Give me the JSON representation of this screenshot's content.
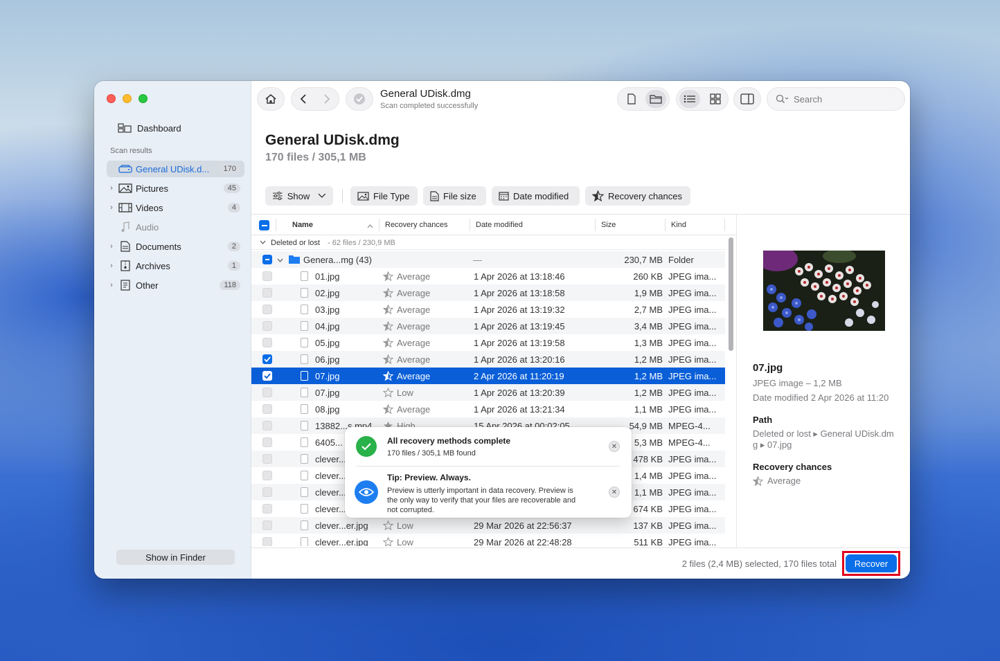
{
  "window": {
    "title": "General UDisk.dmg",
    "subtitle": "Scan completed successfully"
  },
  "sidebar": {
    "dashboard": "Dashboard",
    "section": "Scan results",
    "items": [
      {
        "label": "General UDisk.d...",
        "count": "170",
        "icon": "drive-icon"
      },
      {
        "label": "Pictures",
        "count": "45",
        "icon": "picture-icon"
      },
      {
        "label": "Videos",
        "count": "4",
        "icon": "film-icon"
      },
      {
        "label": "Audio",
        "count": "",
        "icon": "music-note-icon"
      },
      {
        "label": "Documents",
        "count": "2",
        "icon": "document-icon"
      },
      {
        "label": "Archives",
        "count": "1",
        "icon": "archive-icon"
      },
      {
        "label": "Other",
        "count": "118",
        "icon": "other-file-icon"
      }
    ],
    "show_in_finder": "Show in Finder"
  },
  "toolbar": {
    "search_placeholder": "Search"
  },
  "header": {
    "title": "General UDisk.dmg",
    "subtitle": "170 files / 305,1 MB"
  },
  "filters": {
    "show": "Show",
    "file_type": "File Type",
    "file_size": "File size",
    "date_modified": "Date modified",
    "recovery_chances": "Recovery chances"
  },
  "columns": {
    "name": "Name",
    "recovery": "Recovery chances",
    "date": "Date modified",
    "size": "Size",
    "kind": "Kind"
  },
  "group": {
    "label": "Deleted or lost",
    "meta": " - 62 files / 230,9 MB"
  },
  "folder": {
    "name": "Genera...mg (43)",
    "recovery": "—",
    "size": "230,7 MB",
    "kind": "Folder"
  },
  "rows": [
    {
      "name": "01.jpg",
      "recovery": "Average",
      "date": "1 Apr 2026 at 13:18:46",
      "size": "260 KB",
      "kind": "JPEG ima..."
    },
    {
      "name": "02.jpg",
      "recovery": "Average",
      "date": "1 Apr 2026 at 13:18:58",
      "size": "1,9 MB",
      "kind": "JPEG ima..."
    },
    {
      "name": "03.jpg",
      "recovery": "Average",
      "date": "1 Apr 2026 at 13:19:32",
      "size": "2,7 MB",
      "kind": "JPEG ima..."
    },
    {
      "name": "04.jpg",
      "recovery": "Average",
      "date": "1 Apr 2026 at 13:19:45",
      "size": "3,4 MB",
      "kind": "JPEG ima..."
    },
    {
      "name": "05.jpg",
      "recovery": "Average",
      "date": "1 Apr 2026 at 13:19:58",
      "size": "1,3 MB",
      "kind": "JPEG ima..."
    },
    {
      "name": "06.jpg",
      "recovery": "Average",
      "date": "1 Apr 2026 at 13:20:16",
      "size": "1,2 MB",
      "kind": "JPEG ima..."
    },
    {
      "name": "07.jpg",
      "recovery": "Average",
      "date": "2 Apr 2026 at 11:20:19",
      "size": "1,2 MB",
      "kind": "JPEG ima..."
    },
    {
      "name": "07.jpg",
      "recovery": "Low",
      "date": "1 Apr 2026 at 13:20:39",
      "size": "1,2 MB",
      "kind": "JPEG ima..."
    },
    {
      "name": "08.jpg",
      "recovery": "Average",
      "date": "1 Apr 2026 at 13:21:34",
      "size": "1,1 MB",
      "kind": "JPEG ima..."
    },
    {
      "name": "13882...s.mp4",
      "recovery": "High",
      "date": "15 Apr 2026 at 00:02:05",
      "size": "54,9 MB",
      "kind": "MPEG-4..."
    },
    {
      "name": "6405...",
      "recovery": "",
      "date": "",
      "size": "5,3 MB",
      "kind": "MPEG-4..."
    },
    {
      "name": "clever...",
      "recovery": "",
      "date": "",
      "size": "478 KB",
      "kind": "JPEG ima..."
    },
    {
      "name": "clever...",
      "recovery": "",
      "date": "",
      "size": "1,4 MB",
      "kind": "JPEG ima..."
    },
    {
      "name": "clever...",
      "recovery": "",
      "date": "",
      "size": "1,1 MB",
      "kind": "JPEG ima..."
    },
    {
      "name": "clever...",
      "recovery": "",
      "date": "",
      "size": "674 KB",
      "kind": "JPEG ima..."
    },
    {
      "name": "clever...er.jpg",
      "recovery": "Low",
      "date": "29 Mar 2026 at 22:56:37",
      "size": "137 KB",
      "kind": "JPEG ima..."
    },
    {
      "name": "clever...er.jpg",
      "recovery": "Low",
      "date": "29 Mar 2026 at 22:48:28",
      "size": "511 KB",
      "kind": "JPEG ima..."
    }
  ],
  "preview": {
    "filename": "07.jpg",
    "type_size": "JPEG image – 1,2 MB",
    "date": "Date modified 2 Apr 2026 at 11:20",
    "path_label": "Path",
    "path_line1": "Deleted or lost ▸ General UDisk.dm",
    "path_line2": "g ▸ 07.jpg",
    "recovery_label": "Recovery chances",
    "recovery_value": "Average"
  },
  "toast": {
    "title1": "All recovery methods complete",
    "body1": "170 files / 305,1 MB found",
    "title2": "Tip: Preview. Always.",
    "body2_l1": "Preview is utterly important in data recovery. Preview is",
    "body2_l2": "the only way to verify that your files are recoverable and",
    "body2_l3": "not corrupted."
  },
  "footer": {
    "status": "2 files (2,4 MB) selected, 170 files total",
    "recover": "Recover"
  },
  "colors": {
    "accent": "#0a6ee8",
    "selection": "#0a5fd8",
    "highlight": "#e0001b"
  }
}
